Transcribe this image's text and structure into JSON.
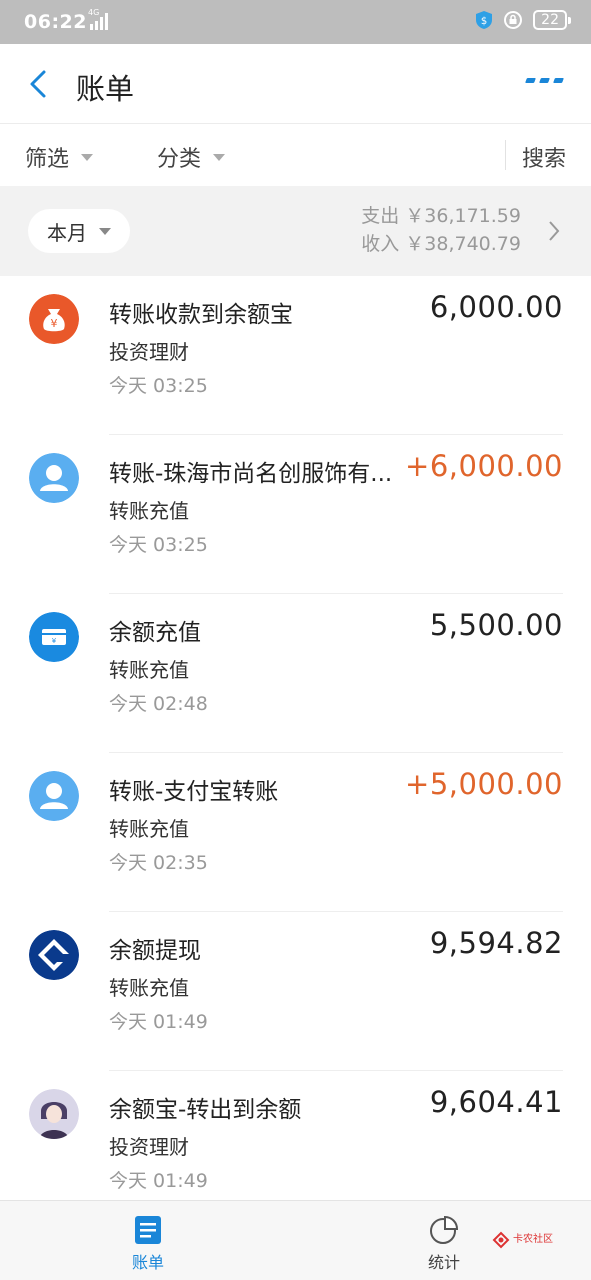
{
  "status_bar": {
    "time": "06:22",
    "network": "4G",
    "battery": "22"
  },
  "nav": {
    "title": "账单"
  },
  "filters": {
    "filter_label": "筛选",
    "category_label": "分类",
    "search_label": "搜索"
  },
  "summary": {
    "month_label": "本月",
    "expense": "支出 ￥36,171.59",
    "income": "收入 ￥38,740.79"
  },
  "transactions": [
    {
      "title": "转账收款到余额宝",
      "category": "投资理财",
      "time": "今天  03:25",
      "amount": "6,000.00",
      "positive": false,
      "icon": "money-bag-icon"
    },
    {
      "title": "转账-珠海市尚名创服饰有...",
      "category": "转账充值",
      "time": "今天  03:25",
      "amount": "+6,000.00",
      "positive": true,
      "icon": "user-avatar-icon"
    },
    {
      "title": "余额充值",
      "category": "转账充值",
      "time": "今天  02:48",
      "amount": "5,500.00",
      "positive": false,
      "icon": "card-icon"
    },
    {
      "title": "转账-支付宝转账",
      "category": "转账充值",
      "time": "今天  02:35",
      "amount": "+5,000.00",
      "positive": true,
      "icon": "user-avatar-icon"
    },
    {
      "title": "余额提现",
      "category": "转账充值",
      "time": "今天  01:49",
      "amount": "9,594.82",
      "positive": false,
      "icon": "ccb-bank-icon"
    },
    {
      "title": "余额宝-转出到余额",
      "category": "投资理财",
      "time": "今天  01:49",
      "amount": "9,604.41",
      "positive": false,
      "icon": "anime-avatar-icon"
    }
  ],
  "tabbar": {
    "bill_label": "账单",
    "stats_label": "统计"
  },
  "watermark": {
    "text": "卡农社区"
  },
  "colors": {
    "accent": "#1a86d8",
    "income": "#e0652c",
    "orange_icon": "#e9582a",
    "navy_icon": "#0a3a8c"
  }
}
